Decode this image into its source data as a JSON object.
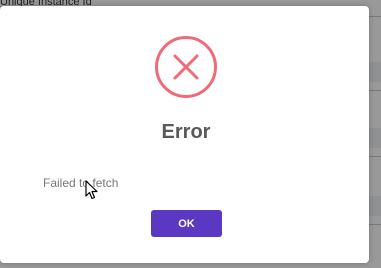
{
  "background": {
    "column_header": "Unique Instance Id"
  },
  "dialog": {
    "icon": "error-x-circle-icon",
    "title": "Error",
    "message": "Failed to fetch",
    "ok_label": "OK"
  },
  "colors": {
    "error_icon": "#f06a78",
    "ok_button": "#5a38c4",
    "title_text": "#595959"
  }
}
